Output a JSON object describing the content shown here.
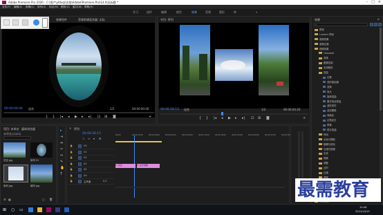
{
  "window": {
    "title": "Adobe Premiere Pro 2020 - C:\\用户\\yfdxqi\\文档\\Adobe\\Premiere Pro\\14.0\\无标题 *"
  },
  "menu": [
    "文件(F)",
    "编辑(E)",
    "剪辑(C)",
    "序列(S)",
    "标记(M)",
    "图形(G)",
    "窗口(W)",
    "帮助(H)"
  ],
  "workspaces": [
    {
      "label": "学习",
      "active": false
    },
    {
      "label": "组件",
      "active": false
    },
    {
      "label": "编辑",
      "active": false
    },
    {
      "label": "颜色",
      "active": false
    },
    {
      "label": "效果",
      "active": true
    },
    {
      "label": "音频",
      "active": false
    },
    {
      "label": "图形",
      "active": false
    },
    {
      "label": "库",
      "active": false
    }
  ],
  "source_panel": {
    "tab": "源:(无剪辑)",
    "tab2": "效果控件",
    "tab3": "音频剪辑混合器: 无标",
    "timecode_left": "00:00:00:00",
    "fit": "适合",
    "ratio": "1/2",
    "timecode_right": "00:00:00:00"
  },
  "program_panel": {
    "tab": "节目: 序列",
    "timecode_left": "00:00:18:13",
    "fit": "适合",
    "ratio": "1/2",
    "timecode_right": "00:00:04:20"
  },
  "project_panel": {
    "tab": "项目: 未命名",
    "tab2": "媒体浏览器",
    "project_name": "未命名.prproj",
    "items": [
      {
        "label": "天空.jpg"
      },
      {
        "label": "序列 01"
      },
      {
        "label": "序列.jpg"
      },
      {
        "label": "城市.jpg"
      }
    ]
  },
  "timeline": {
    "tab": "序列",
    "timecode": "00:00:18:13",
    "tracks": [
      {
        "name": "V3"
      },
      {
        "name": "V2"
      },
      {
        "name": "V1"
      },
      {
        "name": "A1"
      },
      {
        "name": "A2"
      },
      {
        "name": "A3"
      },
      {
        "name": "主声道"
      }
    ],
    "master_value": "0.0",
    "ruler": [
      "00:00",
      "00:00:15:00",
      "00:00:30:00",
      "00:00:45:00",
      "00:01:00:00",
      "00:01:15:00",
      "00:01:30:00",
      "00:01:45:00",
      "00:02:00:00",
      "00:02:15:00",
      "00:02:30:00"
    ],
    "clips": [
      {
        "label": "fx 天空"
      },
      {
        "label": "fx 交叉溶解"
      }
    ]
  },
  "effects_panel": {
    "tab": "效果",
    "tree": [
      {
        "label": "预设",
        "kind": "folder"
      },
      {
        "label": "Lumetri 预设",
        "kind": "folder"
      },
      {
        "label": "音频效果",
        "kind": "folder"
      },
      {
        "label": "音频过渡",
        "kind": "folder"
      },
      {
        "label": "视频效果",
        "kind": "folder"
      },
      {
        "label": "Obsolete",
        "kind": "folder"
      },
      {
        "label": "变换",
        "kind": "folder"
      },
      {
        "label": "图像控制",
        "kind": "folder"
      },
      {
        "label": "实用程序",
        "kind": "folder"
      },
      {
        "label": "扭曲",
        "kind": "folder"
      },
      {
        "label": "位移",
        "kind": "effect"
      },
      {
        "label": "变形稳定器",
        "kind": "effect"
      },
      {
        "label": "变换",
        "kind": "effect"
      },
      {
        "label": "放大",
        "kind": "effect"
      },
      {
        "label": "旋转扭曲",
        "kind": "effect"
      },
      {
        "label": "果冻效应修复",
        "kind": "effect"
      },
      {
        "label": "波形变形",
        "kind": "effect"
      },
      {
        "label": "湍流置换",
        "kind": "effect"
      },
      {
        "label": "球面化",
        "kind": "effect"
      },
      {
        "label": "边角定位",
        "kind": "effect"
      },
      {
        "label": "镜像",
        "kind": "effect"
      },
      {
        "label": "镜头扭曲",
        "kind": "effect"
      },
      {
        "label": "时间",
        "kind": "folder"
      },
      {
        "label": "杂色与颗粒",
        "kind": "folder"
      },
      {
        "label": "模糊与锐化",
        "kind": "folder"
      },
      {
        "label": "沉浸式视频",
        "kind": "folder"
      },
      {
        "label": "生成",
        "kind": "folder"
      },
      {
        "label": "视频",
        "kind": "folder"
      },
      {
        "label": "调整",
        "kind": "folder"
      },
      {
        "label": "过时",
        "kind": "folder"
      },
      {
        "label": "过渡",
        "kind": "folder"
      },
      {
        "label": "透视",
        "kind": "folder"
      },
      {
        "label": "通道",
        "kind": "folder"
      },
      {
        "label": "键控",
        "kind": "folder"
      },
      {
        "label": "颜色校正",
        "kind": "folder"
      },
      {
        "label": "风格化",
        "kind": "folder"
      },
      {
        "label": "视频过渡",
        "kind": "folder"
      }
    ]
  },
  "watermark": "最需教育",
  "taskbar": {
    "time": "10:46",
    "date": "2021/10/15"
  },
  "colors": {
    "accent": "#3f8cff",
    "clip": "#e08be0",
    "folder": "#c9a44a"
  }
}
